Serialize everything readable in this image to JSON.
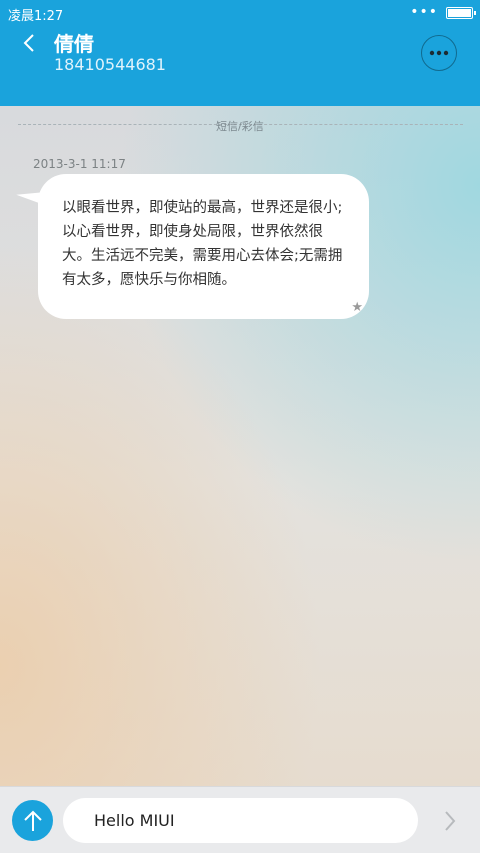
{
  "status_bar": {
    "time": "凌晨1:27",
    "signal": "•••"
  },
  "header": {
    "contact_name": "倩倩",
    "contact_number": "18410544681"
  },
  "thread": {
    "channel_label": "短信/彩信",
    "messages": [
      {
        "timestamp": "2013-3-1 11:17",
        "text": "以眼看世界，即使站的最高，世界还是很小;以心看世界，即使身处局限，世界依然很大。生活远不完美，需要用心去体会;无需拥有太多，愿快乐与你相随。",
        "starred_glyph": "★"
      }
    ]
  },
  "composer": {
    "input_value": "Hello MIUI"
  },
  "colors": {
    "accent": "#1aa3dc"
  }
}
